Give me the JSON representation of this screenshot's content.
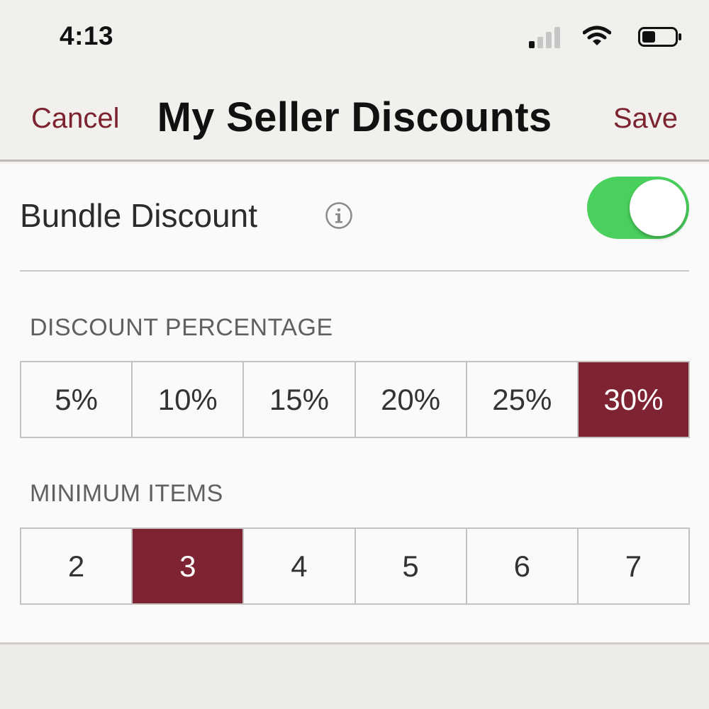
{
  "status_bar": {
    "time": "4:13",
    "icons": [
      "signal-icon",
      "wifi-icon",
      "battery-icon"
    ]
  },
  "nav": {
    "cancel_label": "Cancel",
    "title": "My Seller Discounts",
    "save_label": "Save"
  },
  "bundle": {
    "label": "Bundle Discount",
    "info_icon": "info-icon",
    "enabled": true
  },
  "discount_percentage": {
    "header": "DISCOUNT PERCENTAGE",
    "options": [
      "5%",
      "10%",
      "15%",
      "20%",
      "25%",
      "30%"
    ],
    "selected": "30%"
  },
  "minimum_items": {
    "header": "MINIMUM ITEMS",
    "options": [
      "2",
      "3",
      "4",
      "5",
      "6",
      "7"
    ],
    "selected": "3"
  },
  "colors": {
    "accent": "#7e2331",
    "toggle_on": "#4ad15d",
    "background": "#f2f0ed"
  }
}
